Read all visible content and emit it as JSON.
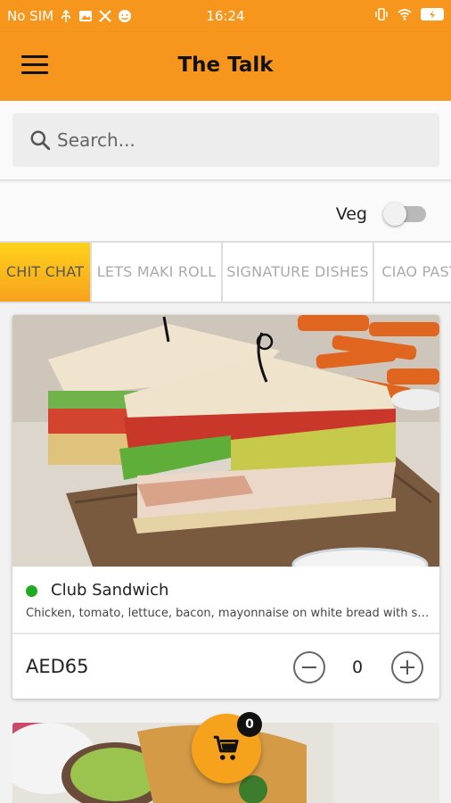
{
  "status_bar": {
    "carrier": "No SIM",
    "time": "16:24",
    "icons": [
      "usb-icon",
      "image-icon",
      "tools-icon",
      "emoji-icon",
      "vibrate-icon",
      "wifi-icon",
      "battery-icon"
    ]
  },
  "app_bar": {
    "title": "The Talk",
    "menu_icon": "hamburger-icon"
  },
  "search": {
    "placeholder": "Search...",
    "value": ""
  },
  "filter": {
    "veg_label": "Veg",
    "veg_on": false
  },
  "categories": [
    {
      "label": "CHIT CHAT",
      "active": true
    },
    {
      "label": "LETS MAKI ROLL",
      "active": false
    },
    {
      "label": "SIGNATURE DISHES",
      "active": false
    },
    {
      "label": "CIAO PASTA",
      "active": false
    }
  ],
  "items": [
    {
      "name": "Club Sandwich",
      "description": "Chicken, tomato, lettuce, bacon, mayonnaise on white bread with sweet potato fries",
      "price": "AED65",
      "quantity": "0",
      "veg": true
    }
  ],
  "cart": {
    "count": "0",
    "icon": "cart-icon"
  },
  "colors": {
    "primary": "#f7961d",
    "active_tab_top": "#ffd21c",
    "active_tab_bottom": "#f7a21c",
    "veg_indicator": "#1faa1f"
  }
}
